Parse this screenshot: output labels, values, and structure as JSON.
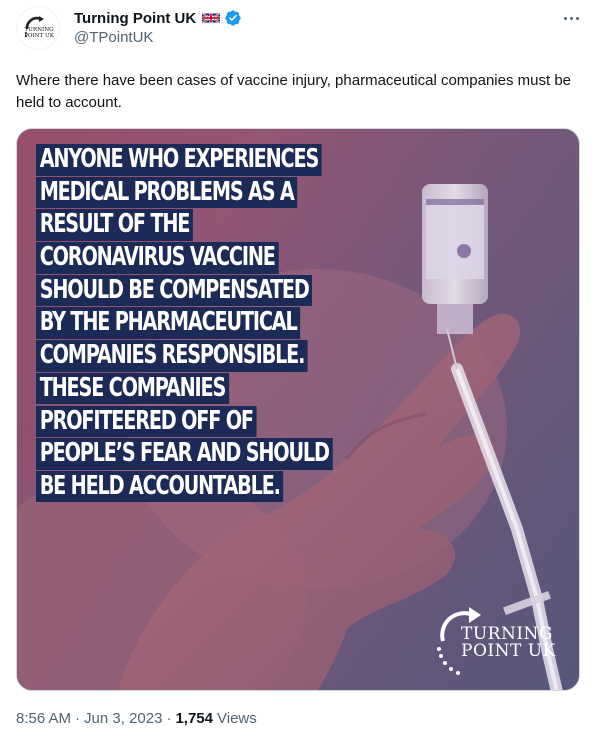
{
  "author": {
    "name": "Turning Point UK",
    "handle": "@TPointUK",
    "avatar_text": [
      "TURNING",
      "POINT UK"
    ],
    "flag": "uk-flag-icon",
    "verified": "verified-badge-icon"
  },
  "tweet": {
    "text": "Where there have been cases of vaccine injury, pharmaceutical companies must be held to account."
  },
  "media": {
    "caption_lines": [
      "ANYONE WHO EXPERIENCES",
      "MEDICAL PROBLEMS AS A",
      "RESULT OF THE",
      "CORONAVIRUS VACCINE",
      "SHOULD BE COMPENSATED",
      "BY THE PHARMACEUTICAL",
      "COMPANIES RESPONSIBLE.",
      "THESE COMPANIES",
      "PROFITEERED OFF OF",
      "PEOPLE’S FEAR AND SHOULD",
      "BE HELD ACCOUNTABLE."
    ],
    "logo_line1": "TURNING",
    "logo_line2": "POINT UK"
  },
  "footer": {
    "time": "8:56 AM",
    "separator": "·",
    "date": "Jun 3, 2023",
    "views_count": "1,754",
    "views_label": "Views"
  },
  "colors": {
    "caption_bg": "#1c2a57",
    "verified_blue": "#1d9bf0",
    "secondary_text": "#536471"
  }
}
